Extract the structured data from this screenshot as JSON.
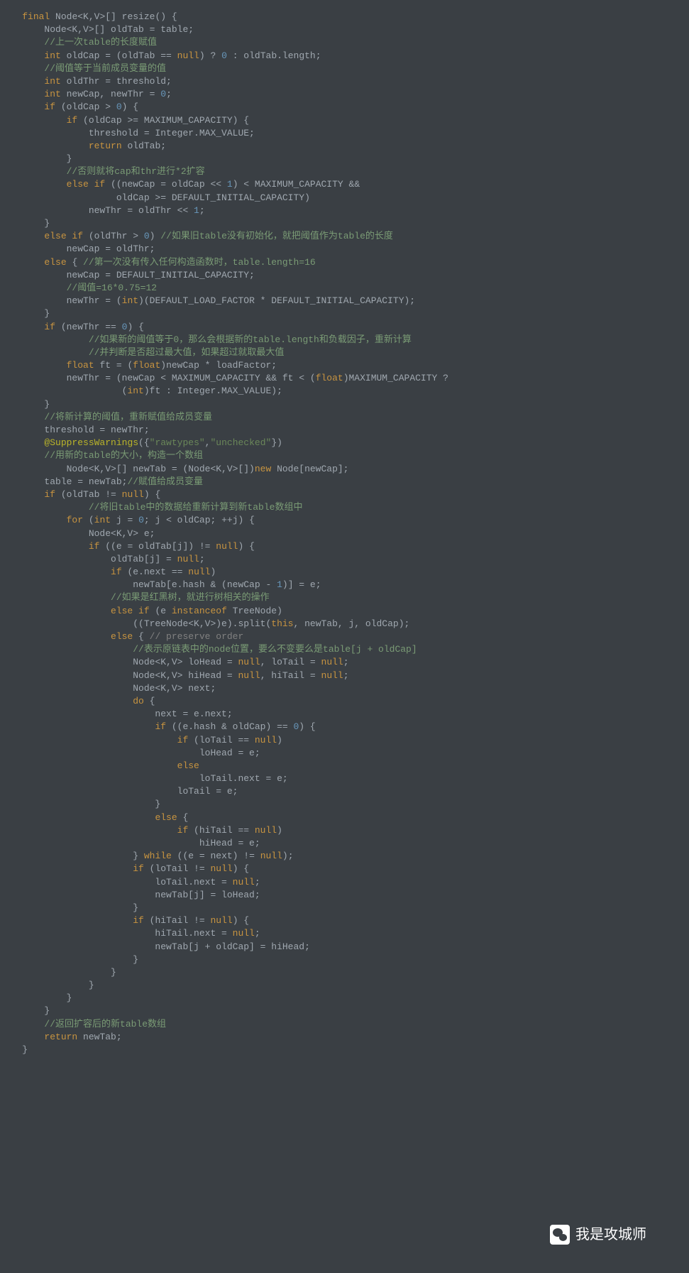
{
  "watermark": "我是攻城师",
  "code_lines": [
    [
      [
        "    "
      ],
      [
        "k",
        "final"
      ],
      [
        " Node<K,V>[] resize() {"
      ]
    ],
    [
      [
        "        Node<K,V>[] oldTab = table;"
      ]
    ],
    [
      [
        "        "
      ],
      [
        "cg",
        "//上一次table的长度赋值"
      ]
    ],
    [
      [
        "        "
      ],
      [
        "k",
        "int"
      ],
      [
        " oldCap = (oldTab == "
      ],
      [
        "k",
        "null"
      ],
      [
        ") ? "
      ],
      [
        "n",
        "0"
      ],
      [
        " : oldTab.length;"
      ]
    ],
    [
      [
        "        "
      ],
      [
        "cg",
        "//阈值等于当前成员变量的值"
      ]
    ],
    [
      [
        "        "
      ],
      [
        "k",
        "int"
      ],
      [
        " oldThr = threshold;"
      ]
    ],
    [
      [
        "        "
      ],
      [
        "k",
        "int"
      ],
      [
        " newCap, newThr = "
      ],
      [
        "n",
        "0"
      ],
      [
        ";"
      ]
    ],
    [
      [
        "        "
      ],
      [
        "k",
        "if"
      ],
      [
        " (oldCap > "
      ],
      [
        "n",
        "0"
      ],
      [
        ") {"
      ]
    ],
    [
      [
        "            "
      ],
      [
        "k",
        "if"
      ],
      [
        " (oldCap >= MAXIMUM_CAPACITY) {"
      ]
    ],
    [
      [
        "                threshold = Integer.MAX_VALUE;"
      ]
    ],
    [
      [
        "                "
      ],
      [
        "k",
        "return"
      ],
      [
        " oldTab;"
      ]
    ],
    [
      [
        "            }"
      ]
    ],
    [
      [
        "            "
      ],
      [
        "cg",
        "//否则就将cap和thr进行*2扩容"
      ]
    ],
    [
      [
        "            "
      ],
      [
        "k",
        "else if"
      ],
      [
        " ((newCap = oldCap << "
      ],
      [
        "n",
        "1"
      ],
      [
        ") < MAXIMUM_CAPACITY &&"
      ]
    ],
    [
      [
        "                     oldCap >= DEFAULT_INITIAL_CAPACITY)"
      ]
    ],
    [
      [
        "                newThr = oldThr << "
      ],
      [
        "n",
        "1"
      ],
      [
        ";"
      ]
    ],
    [
      [
        "        }"
      ]
    ],
    [
      [
        "        "
      ],
      [
        "k",
        "else if"
      ],
      [
        " (oldThr > "
      ],
      [
        "n",
        "0"
      ],
      [
        ") "
      ],
      [
        "cg",
        "//如果旧table没有初始化，就把阈值作为table的长度"
      ]
    ],
    [
      [
        "            newCap = oldThr;"
      ]
    ],
    [
      [
        "        "
      ],
      [
        "k",
        "else"
      ],
      [
        " { "
      ],
      [
        "cg",
        "//第一次没有传入任何构造函数时，table.length=16"
      ]
    ],
    [
      [
        "            newCap = DEFAULT_INITIAL_CAPACITY;"
      ]
    ],
    [
      [
        "            "
      ],
      [
        "cg",
        "//阈值=16*0.75=12"
      ]
    ],
    [
      [
        "            newThr = ("
      ],
      [
        "k",
        "int"
      ],
      [
        ")(DEFAULT_LOAD_FACTOR * DEFAULT_INITIAL_CAPACITY);"
      ]
    ],
    [
      [
        "        }"
      ]
    ],
    [
      [
        "        "
      ],
      [
        "k",
        "if"
      ],
      [
        " (newThr == "
      ],
      [
        "n",
        "0"
      ],
      [
        ") {"
      ]
    ],
    [
      [
        "                "
      ],
      [
        "cg",
        "//如果新的阈值等于0，那么会根据新的table.length和负载因子，重新计算"
      ]
    ],
    [
      [
        "                "
      ],
      [
        "cg",
        "//并判断是否超过最大值，如果超过就取最大值"
      ]
    ],
    [
      [
        "            "
      ],
      [
        "k",
        "float"
      ],
      [
        " ft = ("
      ],
      [
        "k",
        "float"
      ],
      [
        ")newCap * loadFactor;"
      ]
    ],
    [
      [
        "            newThr = (newCap < MAXIMUM_CAPACITY && ft < ("
      ],
      [
        "k",
        "float"
      ],
      [
        ")MAXIMUM_CAPACITY ?"
      ]
    ],
    [
      [
        "                      ("
      ],
      [
        "k",
        "int"
      ],
      [
        ")ft : Integer.MAX_VALUE);"
      ]
    ],
    [
      [
        "        }"
      ]
    ],
    [
      [
        "        "
      ],
      [
        "cg",
        "//将新计算的阈值，重新赋值给成员变量"
      ]
    ],
    [
      [
        "        threshold = newThr;"
      ]
    ],
    [
      [
        "        "
      ],
      [
        "a",
        "@SuppressWarnings"
      ],
      [
        "({"
      ],
      [
        "s",
        "\"rawtypes\""
      ],
      [
        ","
      ],
      [
        "s",
        "\"unchecked\""
      ],
      [
        "})"
      ]
    ],
    [
      [
        "        "
      ],
      [
        "cg",
        "//用新的table的大小，构造一个数组"
      ]
    ],
    [
      [
        "            Node<K,V>[] newTab = (Node<K,V>[])"
      ],
      [
        "k",
        "new"
      ],
      [
        " Node[newCap];"
      ]
    ],
    [
      [
        "        table = newTab;"
      ],
      [
        "cg",
        "//赋值给成员变量"
      ]
    ],
    [
      [
        "        "
      ],
      [
        "k",
        "if"
      ],
      [
        " (oldTab != "
      ],
      [
        "k",
        "null"
      ],
      [
        ") {"
      ]
    ],
    [
      [
        "                "
      ],
      [
        "cg",
        "//将旧table中的数据给重新计算到新table数组中"
      ]
    ],
    [
      [
        "            "
      ],
      [
        "k",
        "for"
      ],
      [
        " ("
      ],
      [
        "k",
        "int"
      ],
      [
        " j = "
      ],
      [
        "n",
        "0"
      ],
      [
        "; j < oldCap; ++j) {"
      ]
    ],
    [
      [
        "                Node<K,V> e;"
      ]
    ],
    [
      [
        "                "
      ],
      [
        "k",
        "if"
      ],
      [
        " ((e = oldTab[j]) != "
      ],
      [
        "k",
        "null"
      ],
      [
        ") {"
      ]
    ],
    [
      [
        "                    oldTab[j] = "
      ],
      [
        "k",
        "null"
      ],
      [
        ";"
      ]
    ],
    [
      [
        "                    "
      ],
      [
        "k",
        "if"
      ],
      [
        " (e.next == "
      ],
      [
        "k",
        "null"
      ],
      [
        ")"
      ]
    ],
    [
      [
        "                        newTab[e.hash & (newCap - "
      ],
      [
        "n",
        "1"
      ],
      [
        ")] = e;"
      ]
    ],
    [
      [
        "                    "
      ],
      [
        "cg",
        "//如果是红黑树，就进行树相关的操作"
      ]
    ],
    [
      [
        "                    "
      ],
      [
        "k",
        "else if"
      ],
      [
        " (e "
      ],
      [
        "k",
        "instanceof"
      ],
      [
        " TreeNode)"
      ]
    ],
    [
      [
        "                        ((TreeNode<K,V>)e).split("
      ],
      [
        "k",
        "this"
      ],
      [
        ", newTab, j, oldCap);"
      ]
    ],
    [
      [
        "                    "
      ],
      [
        "k",
        "else"
      ],
      [
        " { "
      ],
      [
        "c",
        "// preserve order"
      ]
    ],
    [
      [
        "                        "
      ],
      [
        "cg",
        "//表示原链表中的node位置，要么不变要么是table[j + oldCap]"
      ]
    ],
    [
      [
        "                        Node<K,V> loHead = "
      ],
      [
        "k",
        "null"
      ],
      [
        ", loTail = "
      ],
      [
        "k",
        "null"
      ],
      [
        ";"
      ]
    ],
    [
      [
        "                        Node<K,V> hiHead = "
      ],
      [
        "k",
        "null"
      ],
      [
        ", hiTail = "
      ],
      [
        "k",
        "null"
      ],
      [
        ";"
      ]
    ],
    [
      [
        "                        Node<K,V> next;"
      ]
    ],
    [
      [
        "                        "
      ],
      [
        "k",
        "do"
      ],
      [
        " {"
      ]
    ],
    [
      [
        "                            next = e.next;"
      ]
    ],
    [
      [
        "                            "
      ],
      [
        "k",
        "if"
      ],
      [
        " ((e.hash & oldCap) == "
      ],
      [
        "n",
        "0"
      ],
      [
        ") {"
      ]
    ],
    [
      [
        "                                "
      ],
      [
        "k",
        "if"
      ],
      [
        " (loTail == "
      ],
      [
        "k",
        "null"
      ],
      [
        ")"
      ]
    ],
    [
      [
        "                                    loHead = e;"
      ]
    ],
    [
      [
        "                                "
      ],
      [
        "k",
        "else"
      ]
    ],
    [
      [
        "                                    loTail.next = e;"
      ]
    ],
    [
      [
        "                                loTail = e;"
      ]
    ],
    [
      [
        "                            }"
      ]
    ],
    [
      [
        "                            "
      ],
      [
        "k",
        "else"
      ],
      [
        " {"
      ]
    ],
    [
      [
        "                                "
      ],
      [
        "k",
        "if"
      ],
      [
        " (hiTail == "
      ],
      [
        "k",
        "null"
      ],
      [
        ")"
      ]
    ],
    [
      [
        "                                    hiHead = e;"
      ]
    ],
    [
      [
        "                        } "
      ],
      [
        "k",
        "while"
      ],
      [
        " ((e = next) != "
      ],
      [
        "k",
        "null"
      ],
      [
        ");"
      ]
    ],
    [
      [
        "                        "
      ],
      [
        "k",
        "if"
      ],
      [
        " (loTail != "
      ],
      [
        "k",
        "null"
      ],
      [
        ") {"
      ]
    ],
    [
      [
        "                            loTail.next = "
      ],
      [
        "k",
        "null"
      ],
      [
        ";"
      ]
    ],
    [
      [
        "                            newTab[j] = loHead;"
      ]
    ],
    [
      [
        "                        }"
      ]
    ],
    [
      [
        "                        "
      ],
      [
        "k",
        "if"
      ],
      [
        " (hiTail != "
      ],
      [
        "k",
        "null"
      ],
      [
        ") {"
      ]
    ],
    [
      [
        "                            hiTail.next = "
      ],
      [
        "k",
        "null"
      ],
      [
        ";"
      ]
    ],
    [
      [
        "                            newTab[j + oldCap] = hiHead;"
      ]
    ],
    [
      [
        "                        }"
      ]
    ],
    [
      [
        "                    }"
      ]
    ],
    [
      [
        "                }"
      ]
    ],
    [
      [
        "            }"
      ]
    ],
    [
      [
        "        }"
      ]
    ],
    [
      [
        "        "
      ],
      [
        "cg",
        "//返回扩容后的新table数组"
      ]
    ],
    [
      [
        "        "
      ],
      [
        "k",
        "return"
      ],
      [
        " newTab;"
      ]
    ],
    [
      [
        "    }"
      ]
    ]
  ]
}
